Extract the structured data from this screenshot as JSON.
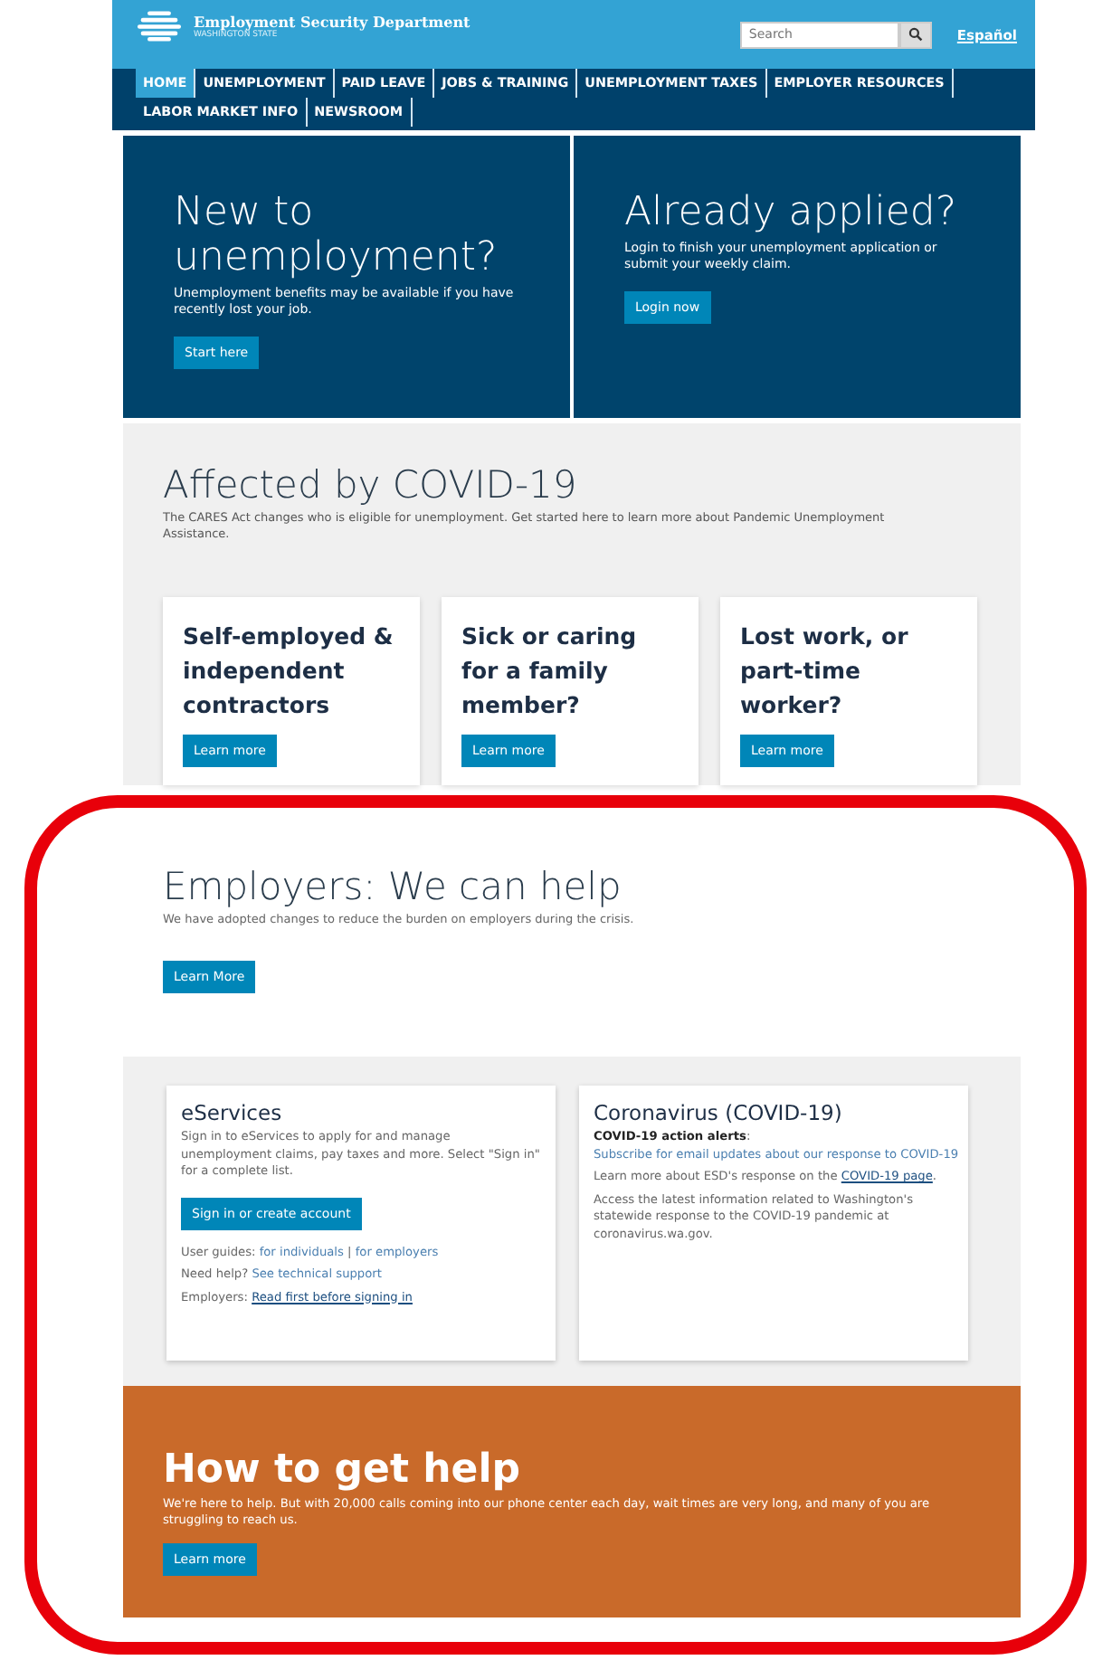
{
  "header": {
    "org_name": "Employment Security Department",
    "org_sub": "WASHINGTON STATE",
    "search": {
      "placeholder": "Search"
    },
    "language_link": "Español"
  },
  "nav": [
    {
      "label": "HOME",
      "selected": true
    },
    {
      "label": "UNEMPLOYMENT",
      "selected": false
    },
    {
      "label": "PAID LEAVE",
      "selected": false
    },
    {
      "label": "JOBS & TRAINING",
      "selected": false
    },
    {
      "label": "UNEMPLOYMENT TAXES",
      "selected": false
    },
    {
      "label": "EMPLOYER RESOURCES",
      "selected": false
    },
    {
      "label": "LABOR MARKET INFO",
      "selected": false
    },
    {
      "label": "NEWSROOM",
      "selected": false
    }
  ],
  "hero": [
    {
      "title": "New to unemployment?",
      "text": "Unemployment benefits may be available if you have recently lost your job.",
      "button": "Start here"
    },
    {
      "title": "Already applied?",
      "text": "Login to finish your unemployment application or submit your weekly claim.",
      "button": "Login now"
    }
  ],
  "covid": {
    "title": "Affected by COVID-19",
    "text": "The CARES Act changes who is eligible for unemployment. Get started here to learn more about Pandemic Unemployment Assistance.",
    "cards": [
      {
        "title": "Self-employed & independent contractors",
        "button": "Learn more"
      },
      {
        "title": "Sick or caring for a family member?",
        "button": "Learn more"
      },
      {
        "title": "Lost work, or part-time worker?",
        "button": "Learn more"
      }
    ]
  },
  "employers": {
    "title": "Employers: We can help",
    "text": "We have adopted changes to reduce the burden on employers during the crisis.",
    "button": "Learn More"
  },
  "info_cards": [
    {
      "title": "eServices",
      "lines": [
        [
          {
            "kind": "plain",
            "text": "Sign in to eServices to apply for and manage unemployment claims, pay taxes and more. Select \"Sign in\" for a complete list."
          }
        ],
        [
          {
            "kind": "button",
            "text": "Sign in or create account"
          }
        ],
        [
          {
            "kind": "plain",
            "text": "User guides: "
          },
          {
            "kind": "link",
            "text": "for individuals"
          },
          {
            "kind": "plain",
            "text": " | "
          },
          {
            "kind": "link",
            "text": "for employers"
          }
        ],
        [
          {
            "kind": "plain",
            "text": "Need help? "
          },
          {
            "kind": "link",
            "text": "See technical support"
          }
        ],
        [
          {
            "kind": "plain",
            "text": "Employers: "
          },
          {
            "kind": "underlined",
            "text": "Read first before signing in"
          }
        ]
      ]
    },
    {
      "title": "Coronavirus (COVID-19)",
      "lines": [
        [
          {
            "kind": "bold",
            "text": "COVID-19 action alerts"
          },
          {
            "kind": "plain",
            "text": ": "
          },
          {
            "kind": "link",
            "text": "Subscribe for email updates about our response to COVID-19"
          }
        ],
        [
          {
            "kind": "plain",
            "text": "Learn more about ESD's response on the "
          },
          {
            "kind": "underlined",
            "text": "COVID-19 page"
          },
          {
            "kind": "plain",
            "text": "."
          }
        ],
        [
          {
            "kind": "plain",
            "text": "Access the latest information related to Washington's statewide response to the COVID-19 pandemic at coronavirus.wa.gov."
          }
        ]
      ]
    }
  ],
  "help": {
    "title": "How to get help",
    "text": "We're here to help. But with 20,000 calls coming into our phone center each day, wait times are very long, and many of you are struggling to reach us.",
    "button": "Learn more"
  },
  "annotation": {
    "kind": "outline"
  }
}
